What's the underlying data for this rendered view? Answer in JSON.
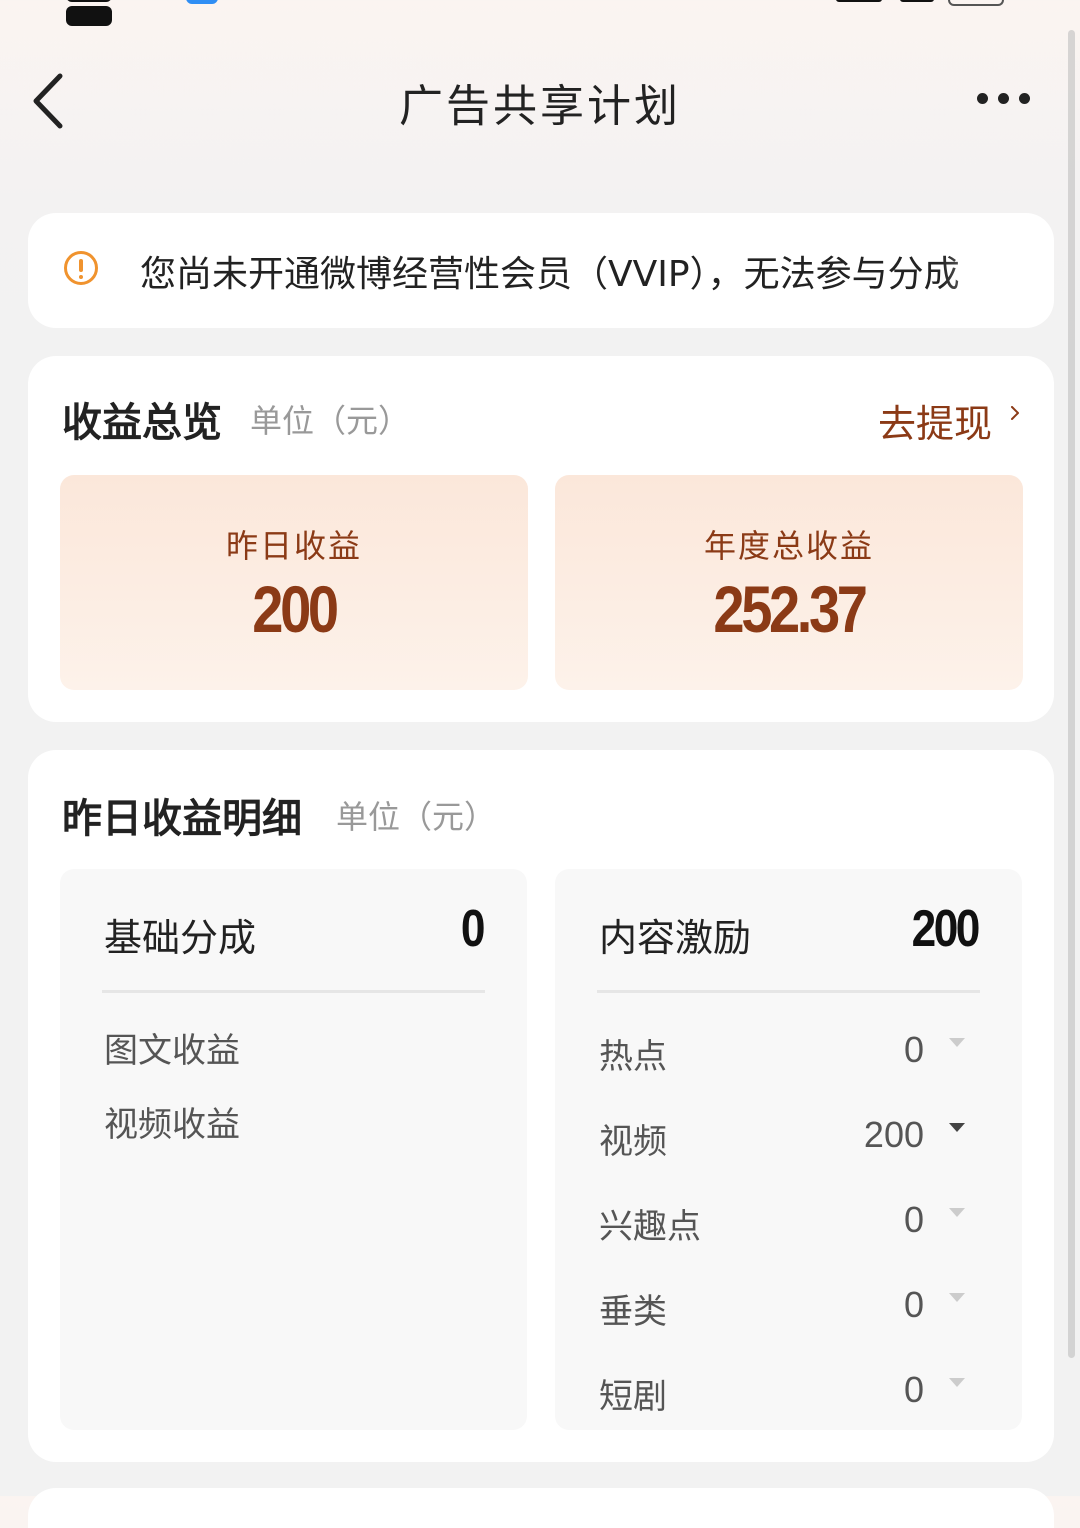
{
  "header": {
    "title": "广告共享计划",
    "back_icon": "chevron-left-icon",
    "more_icon": "ellipsis-icon"
  },
  "notice": {
    "icon": "warning-circle-icon",
    "text": "您尚未开通微博经营性会员（VVIP），无法参与分成",
    "icon_color": "#f0932e"
  },
  "overview": {
    "title": "收益总览",
    "unit": "单位（元）",
    "withdraw_label": "去提现",
    "accent_color": "#8b3a16",
    "stats": [
      {
        "label": "昨日收益",
        "value": "200"
      },
      {
        "label": "年度总收益",
        "value": "252.37"
      }
    ]
  },
  "detail": {
    "title": "昨日收益明细",
    "unit": "单位（元）",
    "base": {
      "label": "基础分成",
      "total": "0",
      "items": [
        "图文收益",
        "视频收益"
      ]
    },
    "content": {
      "label": "内容激励",
      "total": "200",
      "rows": [
        {
          "label": "热点",
          "value": "0"
        },
        {
          "label": "视频",
          "value": "200"
        },
        {
          "label": "兴趣点",
          "value": "0"
        },
        {
          "label": "垂类",
          "value": "0"
        },
        {
          "label": "短剧",
          "value": "0"
        }
      ]
    }
  }
}
